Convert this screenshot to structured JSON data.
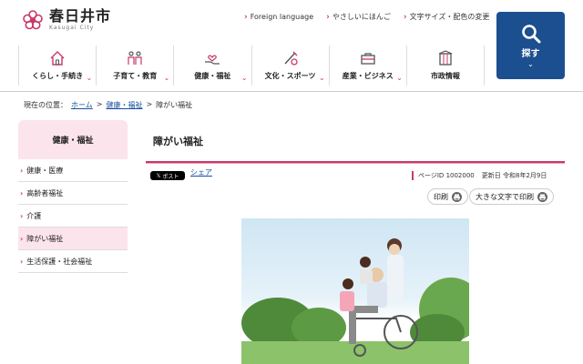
{
  "header": {
    "site_title": "春日井市",
    "site_subtitle": "Kasugai City",
    "util_links": [
      {
        "label": "Foreign language"
      },
      {
        "label": "やさしいにほんご"
      },
      {
        "label": "文字サイズ・配色の変更"
      }
    ],
    "search_label": "探す"
  },
  "gnav": [
    {
      "label": "くらし・手続き",
      "icon": "house-icon"
    },
    {
      "label": "子育て・教育",
      "icon": "family-icon"
    },
    {
      "label": "健康・福祉",
      "icon": "heart-hand-icon"
    },
    {
      "label": "文化・スポーツ",
      "icon": "sports-icon"
    },
    {
      "label": "産業・ビジネス",
      "icon": "briefcase-icon"
    },
    {
      "label": "市政情報",
      "icon": "building-icon"
    }
  ],
  "breadcrumb": {
    "prefix": "現在の位置：",
    "home": "ホーム",
    "parent": "健康・福祉",
    "current": "障がい福祉",
    "sep": ">"
  },
  "sidebar": {
    "heading": "健康・福祉",
    "items": [
      {
        "label": "健康・医療",
        "active": false
      },
      {
        "label": "高齢者福祉",
        "active": false
      },
      {
        "label": "介護",
        "active": false
      },
      {
        "label": "障がい福祉",
        "active": true
      },
      {
        "label": "生活保護・社会福祉",
        "active": false
      }
    ]
  },
  "main": {
    "title": "障がい福祉",
    "x_post_label": "ポスト",
    "share_label": "シェア",
    "page_id_label": "ページID",
    "page_id": "1002000",
    "updated_label": "更新日",
    "updated": "令和8年2月9日",
    "print_label": "印刷",
    "print_large_label": "大きな文字で印刷"
  },
  "colors": {
    "accent": "#c8386b",
    "brand_blue": "#1c4f8f",
    "sidebar_bg": "#fce4ec"
  }
}
